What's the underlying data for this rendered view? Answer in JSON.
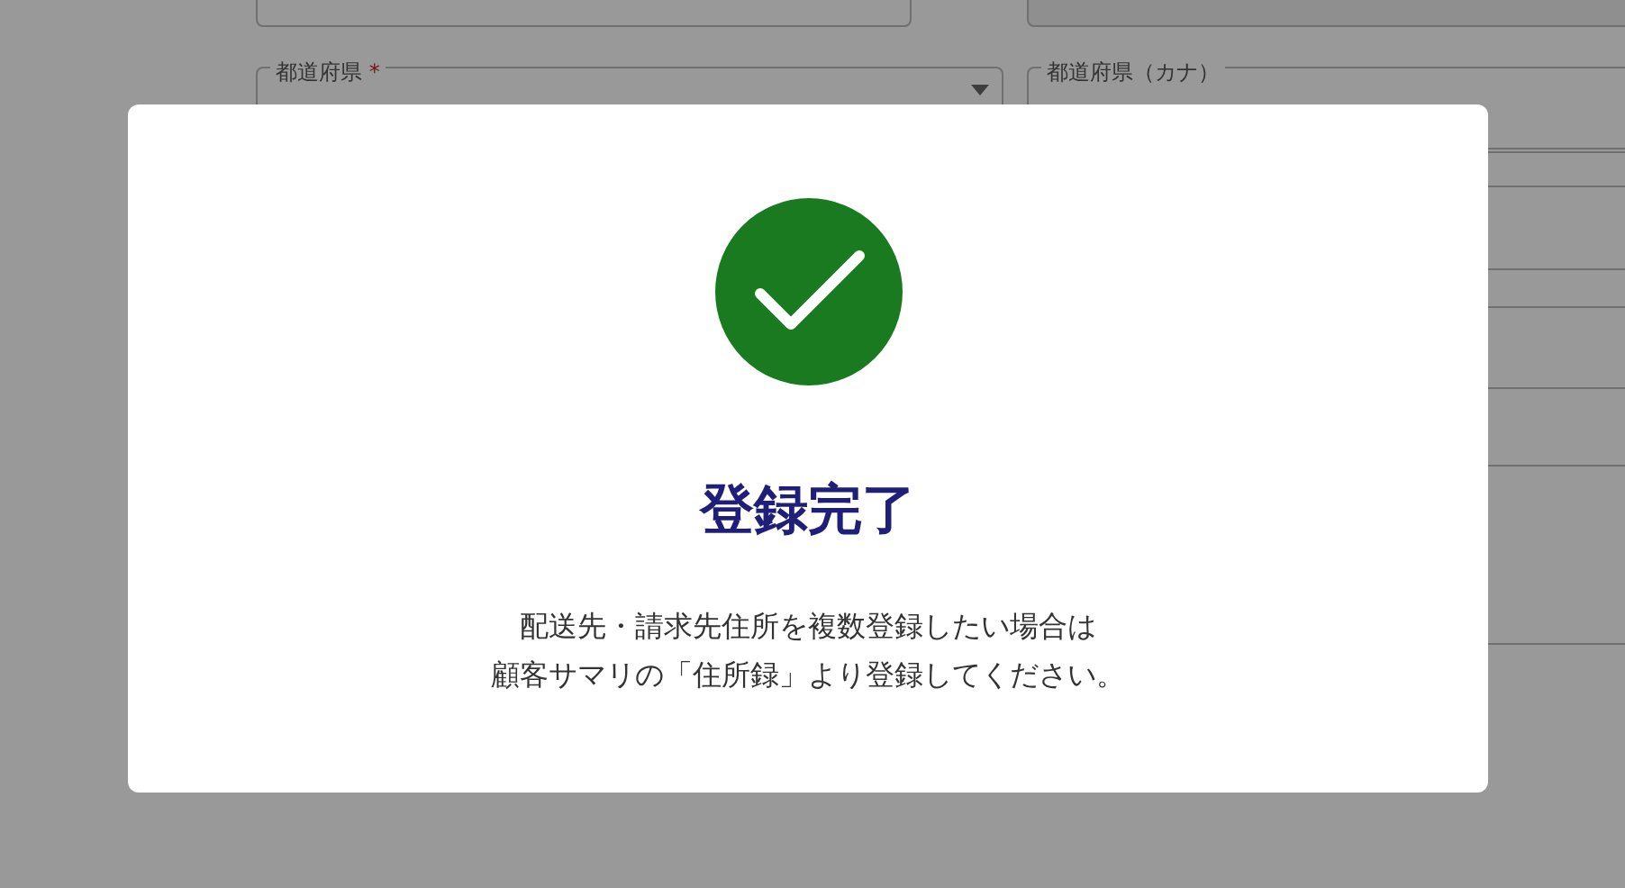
{
  "form": {
    "fields": [
      {
        "label": "都道府県",
        "required_mark": "*",
        "kind": "select"
      },
      {
        "label": "都道府県（カナ）",
        "kind": "text"
      }
    ]
  },
  "dialog": {
    "title": "登録完了",
    "message_lines": [
      "配送先・請求先住所を複数登録したい場合は",
      "顧客サマリの「住所録」より登録してください。"
    ]
  }
}
